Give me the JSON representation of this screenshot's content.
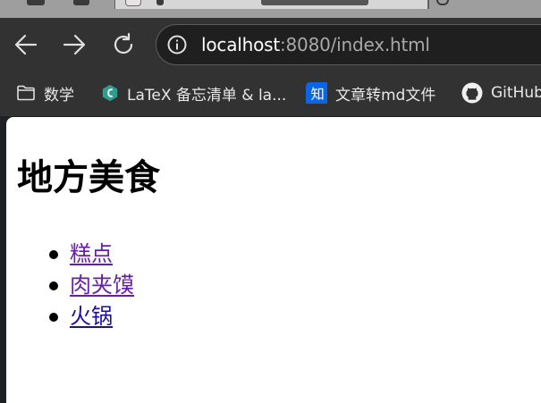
{
  "browser": {
    "colors": {
      "toolbar": "#323232",
      "omnibox": "#1f1f1f",
      "url_host": "#ffffff",
      "url_path": "#a8a8a8"
    },
    "toolbar": {
      "back_icon": "back-arrow-icon",
      "forward_icon": "forward-arrow-icon",
      "reload_icon": "reload-icon"
    },
    "address_bar": {
      "host": "localhost",
      "path": ":8080/index.html",
      "icon": "site-info-icon"
    },
    "bookmarks": [
      {
        "label": "数学",
        "icon": "folder-icon"
      },
      {
        "label": "LaTeX 备忘清单 & la...",
        "icon": "latex-favicon-icon"
      },
      {
        "label": "文章转md文件",
        "icon": "zhihu-favicon-icon"
      },
      {
        "label": "GitHub",
        "icon": "github-icon"
      }
    ]
  },
  "page": {
    "title": "地方美食",
    "links": [
      {
        "label": "糕点",
        "state": "visited"
      },
      {
        "label": "肉夹馍",
        "state": "visited"
      },
      {
        "label": "火锅",
        "state": "unvisited"
      }
    ],
    "colors": {
      "visited_link": "#681da8",
      "unvisited_link": "#1a0dab"
    }
  }
}
